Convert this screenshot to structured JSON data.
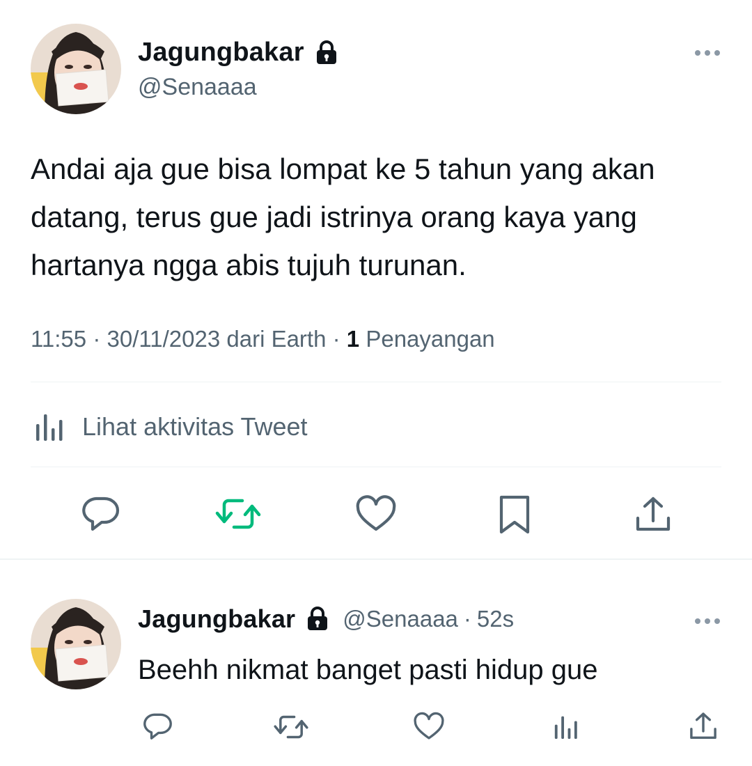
{
  "tweet": {
    "author": {
      "display_name": "Jagungbakar",
      "handle": "@Senaaaa",
      "protected_icon": "lock-icon"
    },
    "text": "Andai aja gue bisa lompat ke 5 tahun yang akan datang, terus gue jadi istrinya orang kaya yang hartanya ngga abis tujuh turunan.",
    "time": "11:55",
    "date": "30/11/2023",
    "source": "dari Earth",
    "separator": "·",
    "view_count": "1",
    "view_label": "Penayangan",
    "activity_label": "Lihat aktivitas Tweet",
    "more_icon": "more-horizontal-icon",
    "actions": [
      {
        "icon": "reply-icon",
        "color": "#536471"
      },
      {
        "icon": "retweet-icon",
        "color": "#00ba7c"
      },
      {
        "icon": "like-icon",
        "color": "#536471"
      },
      {
        "icon": "bookmark-icon",
        "color": "#536471"
      },
      {
        "icon": "share-icon",
        "color": "#536471"
      }
    ]
  },
  "reply": {
    "author": {
      "display_name": "Jagungbakar",
      "handle": "@Senaaaa",
      "protected_icon": "lock-icon"
    },
    "separator": "·",
    "time": "52s",
    "text": "Beehh nikmat banget pasti hidup gue",
    "actions": [
      {
        "icon": "reply-icon"
      },
      {
        "icon": "retweet-icon"
      },
      {
        "icon": "like-icon"
      },
      {
        "icon": "stats-icon"
      },
      {
        "icon": "share-icon"
      }
    ]
  },
  "colors": {
    "text_primary": "#0f1419",
    "text_secondary": "#536471",
    "divider": "#eff3f4",
    "retweet_active": "#00ba7c"
  }
}
